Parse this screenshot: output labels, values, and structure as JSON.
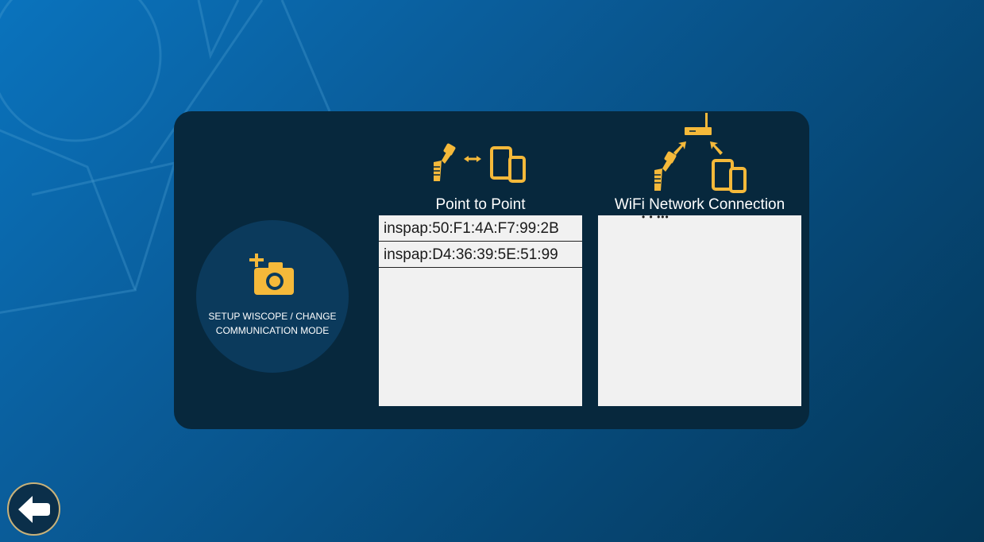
{
  "setup": {
    "label_line1": "SETUP WISCOPE / CHANGE",
    "label_line2": "COMMUNICATION MODE",
    "icon": "add-camera-icon"
  },
  "point_to_point": {
    "title": "Point to Point",
    "icon": "scope-to-device-icon",
    "devices": [
      "inspap:50:F1:4A:F7:99:2B",
      "inspap:D4:36:39:5E:51:99"
    ]
  },
  "wifi_network": {
    "title": "WiFi Network Connection",
    "icon": "router-network-icon",
    "loading_indicator": "•  •  •••",
    "devices": []
  },
  "back": {
    "icon": "back-arrow-icon"
  },
  "colors": {
    "accent": "#f5b93a",
    "panel": "#07283d",
    "list_bg": "#f1f1f1"
  }
}
